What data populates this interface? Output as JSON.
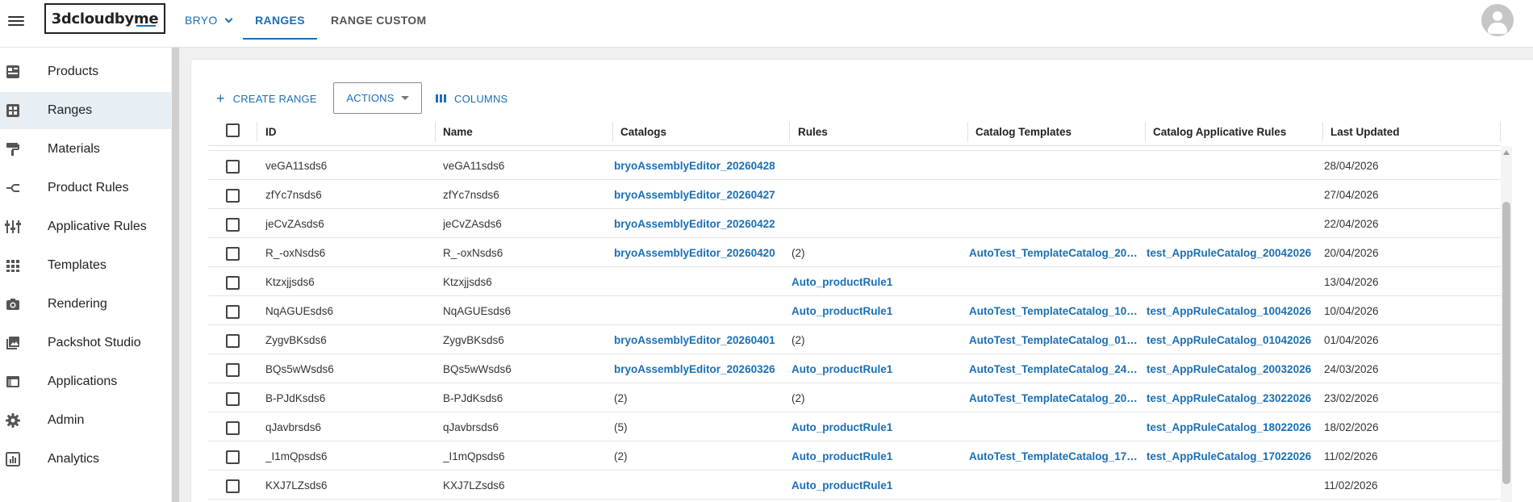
{
  "app": {
    "logo_text": "3dcloudbyme",
    "nav": {
      "workspace": "BRYO",
      "ranges": "RANGES",
      "range_custom": "RANGE CUSTOM"
    },
    "accent_color": "#1a6fb5"
  },
  "sidebar": {
    "items": [
      {
        "label": "Products",
        "icon": "products-icon"
      },
      {
        "label": "Ranges",
        "icon": "ranges-icon",
        "active": true
      },
      {
        "label": "Materials",
        "icon": "materials-icon"
      },
      {
        "label": "Product Rules",
        "icon": "product-rules-icon"
      },
      {
        "label": "Applicative Rules",
        "icon": "applicative-rules-icon"
      },
      {
        "label": "Templates",
        "icon": "templates-icon"
      },
      {
        "label": "Rendering",
        "icon": "camera-icon"
      },
      {
        "label": "Packshot Studio",
        "icon": "gallery-icon"
      },
      {
        "label": "Applications",
        "icon": "applications-icon"
      },
      {
        "label": "Admin",
        "icon": "gear-icon"
      },
      {
        "label": "Analytics",
        "icon": "analytics-icon"
      }
    ]
  },
  "toolbar": {
    "create_label": "CREATE RANGE",
    "actions_label": "ACTIONS",
    "columns_label": "COLUMNS"
  },
  "table": {
    "columns": [
      "ID",
      "Name",
      "Catalogs",
      "Rules",
      "Catalog Templates",
      "Catalog Applicative Rules",
      "Last Updated"
    ],
    "rows": [
      {
        "id": "veGA11sds6",
        "name": "veGA11sds6",
        "catalogs": "bryoAssemblyEditor_20260428",
        "rules": "",
        "templates": "",
        "app_rules": "",
        "updated": "28/04/2026"
      },
      {
        "id": "zfYc7nsds6",
        "name": "zfYc7nsds6",
        "catalogs": "bryoAssemblyEditor_20260427",
        "rules": "",
        "templates": "",
        "app_rules": "",
        "updated": "27/04/2026"
      },
      {
        "id": "jeCvZAsds6",
        "name": "jeCvZAsds6",
        "catalogs": "bryoAssemblyEditor_20260422",
        "rules": "",
        "templates": "",
        "app_rules": "",
        "updated": "22/04/2026"
      },
      {
        "id": "R_-oxNsds6",
        "name": "R_-oxNsds6",
        "catalogs": "bryoAssemblyEditor_20260420",
        "rules": "(2)",
        "templates": "AutoTest_TemplateCatalog_20…",
        "app_rules": "test_AppRuleCatalog_20042026",
        "updated": "20/04/2026"
      },
      {
        "id": "Ktzxjjsds6",
        "name": "Ktzxjjsds6",
        "catalogs": "",
        "rules": "Auto_productRule1",
        "templates": "",
        "app_rules": "",
        "updated": "13/04/2026"
      },
      {
        "id": "NqAGUEsds6",
        "name": "NqAGUEsds6",
        "catalogs": "",
        "rules": "Auto_productRule1",
        "templates": "AutoTest_TemplateCatalog_10…",
        "app_rules": "test_AppRuleCatalog_10042026",
        "updated": "10/04/2026"
      },
      {
        "id": "ZygvBKsds6",
        "name": "ZygvBKsds6",
        "catalogs": "bryoAssemblyEditor_20260401",
        "rules": "(2)",
        "templates": "AutoTest_TemplateCatalog_01…",
        "app_rules": "test_AppRuleCatalog_01042026",
        "updated": "01/04/2026"
      },
      {
        "id": "BQs5wWsds6",
        "name": "BQs5wWsds6",
        "catalogs": "bryoAssemblyEditor_20260326",
        "rules": "Auto_productRule1",
        "templates": "AutoTest_TemplateCatalog_24…",
        "app_rules": "test_AppRuleCatalog_20032026",
        "updated": "24/03/2026"
      },
      {
        "id": "B-PJdKsds6",
        "name": "B-PJdKsds6",
        "catalogs": "(2)",
        "rules": "(2)",
        "templates": "AutoTest_TemplateCatalog_20…",
        "app_rules": "test_AppRuleCatalog_23022026",
        "updated": "23/02/2026"
      },
      {
        "id": "qJavbrsds6",
        "name": "qJavbrsds6",
        "catalogs": "(5)",
        "rules": "Auto_productRule1",
        "templates": "",
        "app_rules": "test_AppRuleCatalog_18022026",
        "updated": "18/02/2026"
      },
      {
        "id": "_I1mQpsds6",
        "name": "_I1mQpsds6",
        "catalogs": "(2)",
        "rules": "Auto_productRule1",
        "templates": "AutoTest_TemplateCatalog_17…",
        "app_rules": "test_AppRuleCatalog_17022026",
        "updated": "11/02/2026"
      },
      {
        "id": "KXJ7LZsds6",
        "name": "KXJ7LZsds6",
        "catalogs": "",
        "rules": "Auto_productRule1",
        "templates": "",
        "app_rules": "",
        "updated": "11/02/2026"
      }
    ]
  }
}
